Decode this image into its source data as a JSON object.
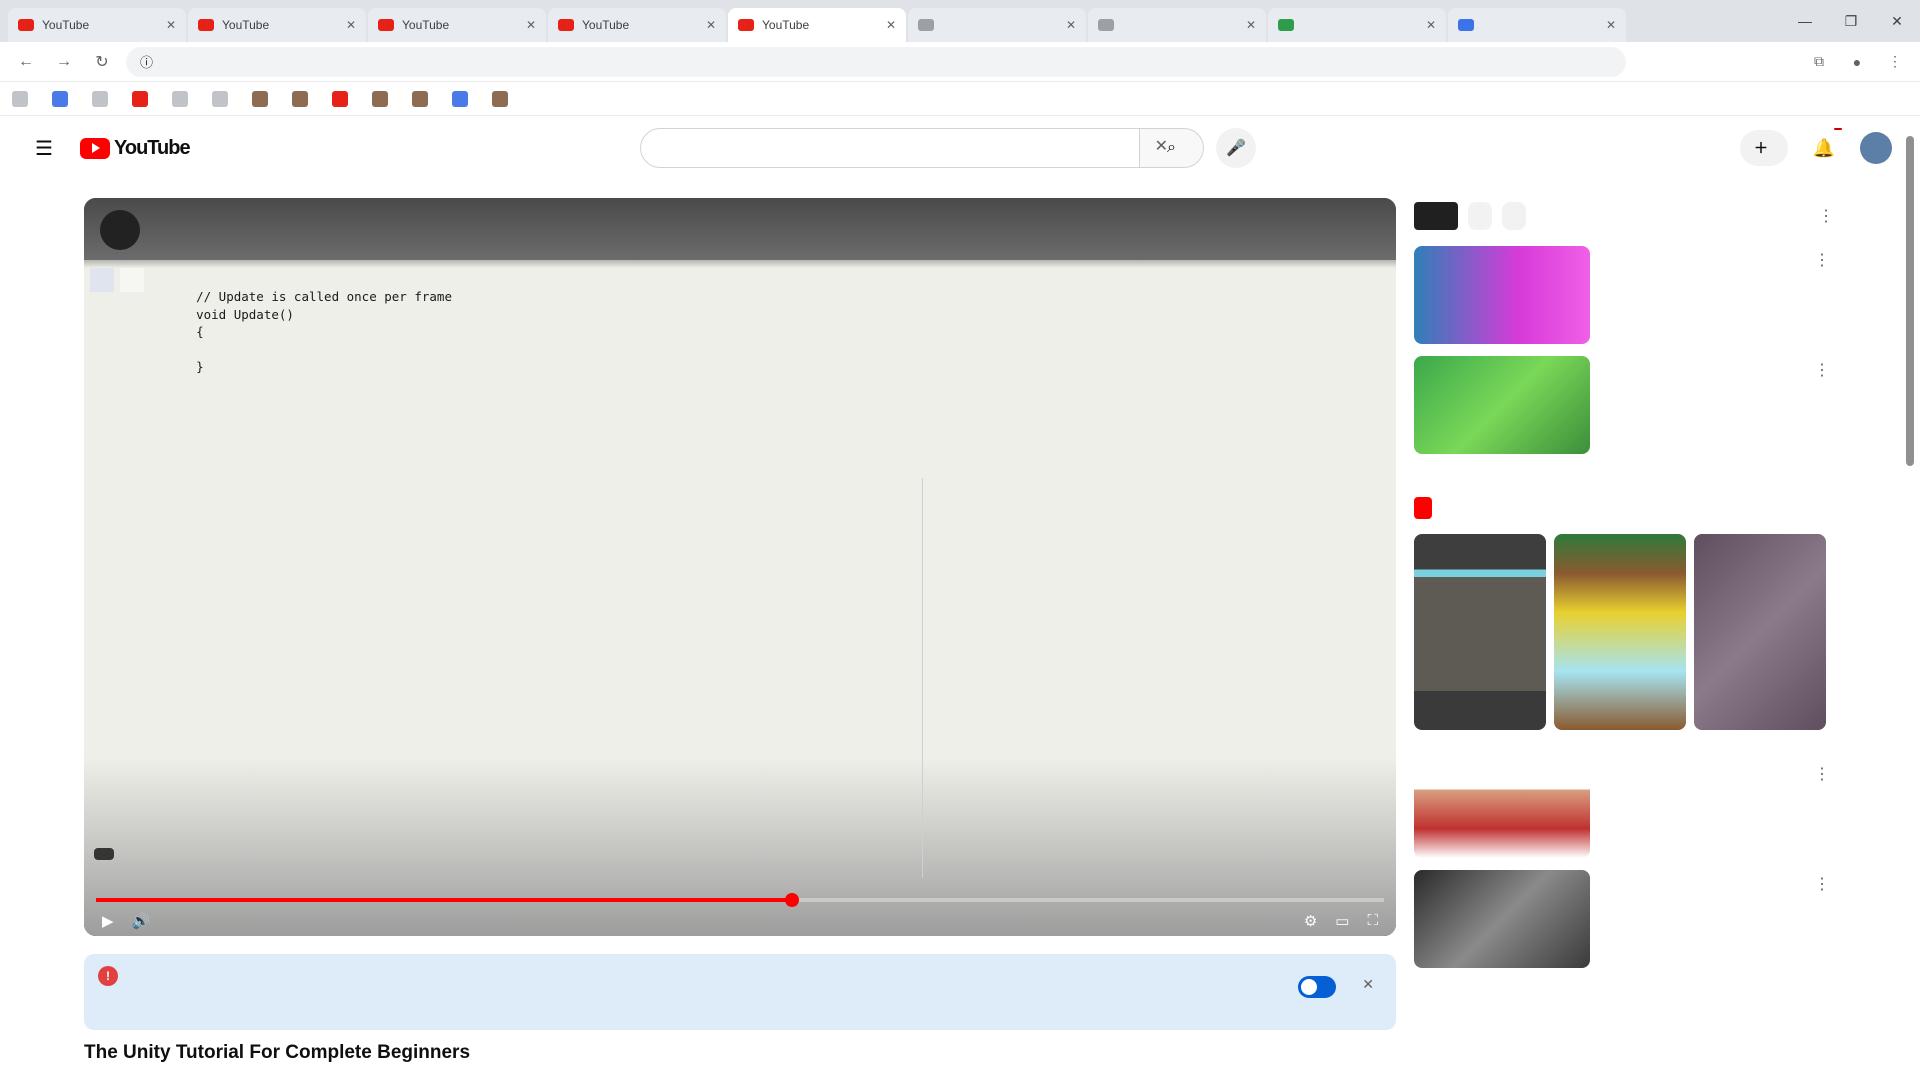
{
  "browser": {
    "tabs": [
      {
        "label": "YouTube",
        "fav": "red"
      },
      {
        "label": "YouTube",
        "fav": "red"
      },
      {
        "label": "YouTube",
        "fav": "red"
      },
      {
        "label": "YouTube",
        "fav": "red"
      },
      {
        "label": "YouTube",
        "fav": "red",
        "active": true
      },
      {
        "label": "",
        "fav": "gray"
      },
      {
        "label": "",
        "fav": "gray"
      },
      {
        "label": "",
        "fav": "green"
      },
      {
        "label": "",
        "fav": "blue"
      }
    ],
    "close_glyph": "✕",
    "window_controls": [
      "—",
      "❐",
      "✕"
    ],
    "url": "",
    "bookmarks": [
      {
        "label": "",
        "icon": "gray"
      },
      {
        "label": "",
        "icon": "blue"
      },
      {
        "label": "",
        "icon": "gray"
      },
      {
        "label": "",
        "icon": "red"
      },
      {
        "label": "",
        "icon": "gray"
      },
      {
        "label": "",
        "icon": "gray"
      },
      {
        "label": "",
        "icon": "brown"
      },
      {
        "label": "",
        "icon": "brown"
      },
      {
        "label": "",
        "icon": "red"
      },
      {
        "label": "",
        "icon": "brown"
      },
      {
        "label": "",
        "icon": "brown"
      },
      {
        "label": "",
        "icon": "blue"
      },
      {
        "label": "",
        "icon": "brown"
      }
    ]
  },
  "youtube": {
    "logo_word": "YouTube",
    "country_code": "",
    "search": {
      "value": "",
      "placeholder": ""
    },
    "create_label": "",
    "notification_count": ""
  },
  "player": {
    "tabs": [
      "",
      ""
    ],
    "code_lines": [
      {
        "n": "",
        "t": "    // Update is called once per frame",
        "c": "c-comment"
      },
      {
        "n": "",
        "t": "    void Update()",
        "c": "c-kw"
      },
      {
        "n": "",
        "t": "    {",
        "c": ""
      },
      {
        "n": "",
        "t": "        ",
        "c": ""
      },
      {
        "n": "",
        "t": "    }",
        "c": ""
      },
      {
        "n": "",
        "t": "",
        "c": ""
      },
      {
        "n": "",
        "t": "",
        "c": ""
      },
      {
        "n": "",
        "t": "",
        "c": ""
      },
      {
        "n": "",
        "t": "",
        "c": ""
      },
      {
        "n": "",
        "t": "",
        "c": ""
      },
      {
        "n": "",
        "t": "",
        "c": ""
      },
      {
        "n": "",
        "t": "",
        "c": ""
      },
      {
        "n": "",
        "t": "",
        "c": ""
      },
      {
        "n": "",
        "t": "",
        "c": ""
      },
      {
        "n": "",
        "t": "",
        "c": ""
      },
      {
        "n": "",
        "t": "",
        "c": ""
      },
      {
        "n": "",
        "t": "",
        "c": ""
      },
      {
        "n": "",
        "t": "",
        "c": ""
      },
      {
        "n": "",
        "t": "",
        "c": ""
      },
      {
        "n": "",
        "t": "",
        "c": ""
      },
      {
        "n": "",
        "t": "",
        "c": ""
      },
      {
        "n": "",
        "t": "",
        "c": ""
      },
      {
        "n": "",
        "t": "",
        "c": ""
      }
    ],
    "chip_label": "",
    "progress_fraction": 0.54,
    "play_glyph": "▶",
    "volume_glyph": "🔊",
    "time_text": "",
    "chapter_text": "",
    "right_controls": [
      "⚙",
      "▭",
      "⛶"
    ]
  },
  "notice": {
    "title": "",
    "text": "",
    "close_glyph": "✕"
  },
  "video_title": "The Unity Tutorial For Complete Beginners",
  "sidebar": {
    "ad_chips": [
      "",
      ""
    ],
    "recommendations_top": [
      {
        "title": "",
        "channel": "",
        "stats": "",
        "thumb": "linear-gradient(90deg,#2f7fb8,#d83ad8 60%,#f060e8)"
      },
      {
        "title": "",
        "channel": "",
        "stats": "",
        "thumb": "linear-gradient(135deg,#3aa84a,#7ad858 50%,#3c8e3a)"
      }
    ],
    "shorts_title": "",
    "shorts": [
      {
        "title": "",
        "views": "",
        "thumb": "linear-gradient(#3e3e3e 0,#3e3e3e 18%,#7ad0e0 18%,#7ad0e0 22%,#5e5b55 22%,#5e5b55 80%,#3a3a3a 80%)"
      },
      {
        "title": "",
        "views": "",
        "thumb": "linear-gradient(#2f7a3a 0,#8a5a30 20%,#e8d030 40%,#a6e4f0 70%,#8a5a30 100%)"
      },
      {
        "title": "",
        "views": "",
        "thumb": "linear-gradient(135deg,#5e4e5e,#8a7a8a 50%,#5e4e5e)"
      }
    ],
    "recommendations_bottom": [
      {
        "title": "",
        "channel": "",
        "stats": "",
        "thumb": "linear-gradient(180deg,#ffffff 0,#ffffff 30%,#d8a080 30%,#c03030 70%,#ffffff 100%)"
      },
      {
        "title": "",
        "channel": "",
        "stats": "",
        "thumb": "linear-gradient(135deg,#2a2a2a,#8a8a8a 50%,#3a3a3a)"
      }
    ],
    "more_glyph": "⋮"
  },
  "colors": {
    "accent": "#ff0000",
    "notice_bg": "#deecf9",
    "toggle": "#065fd4"
  }
}
